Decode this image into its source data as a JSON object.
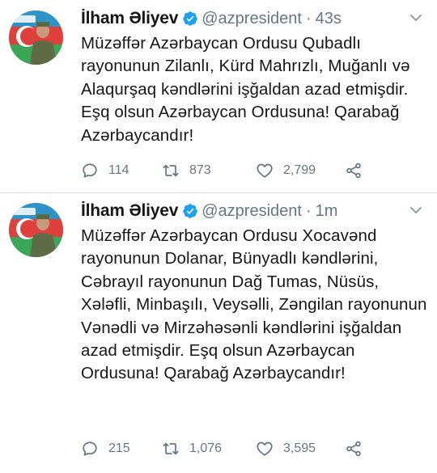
{
  "tweets": [
    {
      "author_name": "İlham Əliyev",
      "handle": "@azpresident",
      "separator": "·",
      "time": "43s",
      "text": "Müzəffər Azərbaycan Ordusu Qubadlı rayonunun Zilanlı, Kürd Mahrızlı, Muğanlı və Alaqurşaq kəndlərini işğaldan azad etmişdir. Eşq olsun Azərbaycan Ordusuna! Qarabağ Azərbaycandır!",
      "replies": "114",
      "retweets": "873",
      "likes": "2,799"
    },
    {
      "author_name": "İlham Əliyev",
      "handle": "@azpresident",
      "separator": "·",
      "time": "1m",
      "text": "Müzəffər Azərbaycan Ordusu Xocavənd rayonunun Dolanar, Bünyadlı kəndlərini, Cəbrayıl rayonunun Dağ Tumas, Nüsüs, Xələfli, Minbaşılı, Veysəlli, Zəngilan rayonunun Vənədli və Mirzəhəsənli kəndlərini işğaldan azad etmişdir. Eşq olsun Azərbaycan Ordusuna! Qarabağ Azərbaycandır!",
      "replies": "215",
      "retweets": "1,076",
      "likes": "3,595"
    }
  ],
  "icons": {
    "verified": "verified-badge-icon",
    "caret": "chevron-down-icon",
    "reply": "reply-icon",
    "retweet": "retweet-icon",
    "like": "heart-icon",
    "share": "share-icon"
  },
  "colors": {
    "text": "#14171a",
    "secondary": "#657786",
    "verified": "#1da1f2",
    "divider": "#d8dee3"
  }
}
